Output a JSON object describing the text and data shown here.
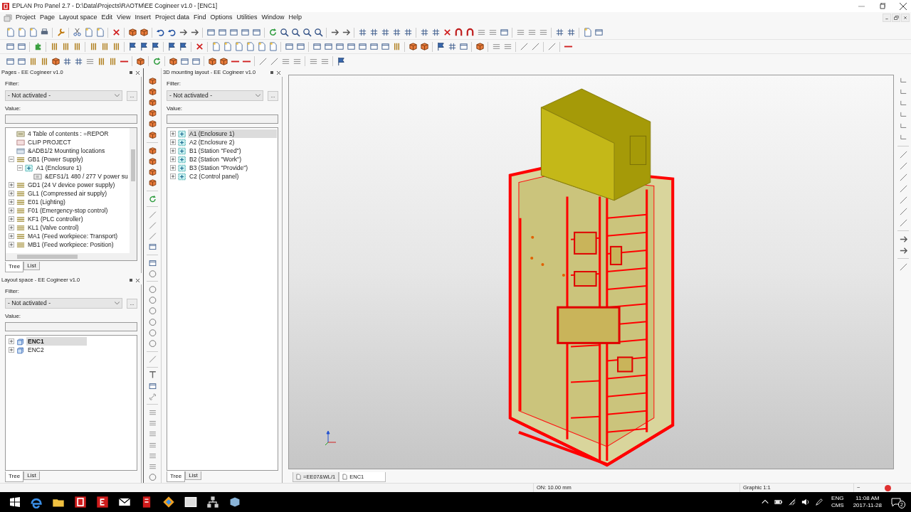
{
  "window": {
    "title": "EPLAN Pro Panel 2.7 - D:\\Data\\Projects\\RAOTM\\EE Cogineer v1.0 - [ENC1]"
  },
  "menu": [
    "Project",
    "Page",
    "Layout space",
    "Edit",
    "View",
    "Insert",
    "Project data",
    "Find",
    "Options",
    "Utilities",
    "Window",
    "Help"
  ],
  "pages_panel": {
    "title": "Pages - EE Cogineer v1.0",
    "filter_label": "Filter:",
    "filter_value": "- Not activated -",
    "more_button": "...",
    "value_label": "Value:",
    "tree": [
      {
        "label": "4 Table of contents : =REPOR",
        "kind": "report"
      },
      {
        "label": "CLIP PROJECT",
        "kind": "page"
      },
      {
        "label": "&ADB1/2 Mounting locations",
        "kind": "layout"
      },
      {
        "label": "GB1 (Power Supply)",
        "kind": "function",
        "expanded": true,
        "children": [
          {
            "label": "A1 (Enclosure 1)",
            "kind": "location",
            "expanded": true,
            "children": [
              {
                "label": "&EFS1/1 480 / 277 V power su",
                "kind": "device"
              }
            ]
          }
        ]
      },
      {
        "label": "GD1 (24 V device power supply)",
        "kind": "function",
        "expanded": false
      },
      {
        "label": "GL1 (Compressed air supply)",
        "kind": "function",
        "expanded": false
      },
      {
        "label": "E01 (Lighting)",
        "kind": "function",
        "expanded": false
      },
      {
        "label": "F01 (Emergency-stop control)",
        "kind": "function",
        "expanded": false
      },
      {
        "label": "KF1 (PLC controller)",
        "kind": "function",
        "expanded": false
      },
      {
        "label": "KL1 (Valve control)",
        "kind": "function",
        "expanded": false
      },
      {
        "label": "MA1 (Feed workpiece: Transport)",
        "kind": "function",
        "expanded": false
      },
      {
        "label": "MB1 (Feed workpiece: Position)",
        "kind": "function",
        "expanded": false
      }
    ],
    "tabs": [
      {
        "label": "Tree",
        "selected": true
      },
      {
        "label": "List",
        "selected": false
      }
    ]
  },
  "layout_panel": {
    "title": "Layout space - EE Cogineer v1.0",
    "filter_label": "Filter:",
    "filter_value": "- Not activated -",
    "more_button": "...",
    "value_label": "Value:",
    "tree": [
      {
        "label": "ENC1",
        "kind": "enclosure",
        "expanded": false,
        "selected": true
      },
      {
        "label": "ENC2",
        "kind": "enclosure",
        "expanded": false,
        "selected": false
      }
    ],
    "tabs": [
      {
        "label": "Tree",
        "selected": true
      },
      {
        "label": "List",
        "selected": false
      }
    ]
  },
  "mounting_panel": {
    "title": "3D mounting layout - EE Cogineer v1.0",
    "filter_label": "Filter:",
    "filter_value": "- Not activated -",
    "more_button": "...",
    "value_label": "Value:",
    "tree": [
      {
        "label": "A1 (Enclosure 1)",
        "kind": "location",
        "expanded": false,
        "selected": true
      },
      {
        "label": "A2 (Enclosure 2)",
        "kind": "location",
        "expanded": false,
        "selected": false
      },
      {
        "label": "B1 (Station \"Feed\")",
        "kind": "location",
        "expanded": false,
        "selected": false
      },
      {
        "label": "B2 (Station \"Work\")",
        "kind": "location",
        "expanded": false,
        "selected": false
      },
      {
        "label": "B3 (Station \"Provide\")",
        "kind": "location",
        "expanded": false,
        "selected": false
      },
      {
        "label": "C2 (Control panel)",
        "kind": "location",
        "expanded": false,
        "selected": false
      }
    ],
    "tabs": [
      {
        "label": "Tree",
        "selected": true
      },
      {
        "label": "List",
        "selected": false
      }
    ]
  },
  "document_tabs": [
    {
      "label": "=EE07&WL/1",
      "selected": false
    },
    {
      "label": "ENC1",
      "selected": true
    }
  ],
  "status_bar": [
    "ON: 10.00 mm",
    "Graphic 1:1",
    "~"
  ],
  "tray": {
    "language": "ENG",
    "layout": "CMS",
    "time": "11:08 AM",
    "date": "2017-11-28",
    "notifications": "2"
  }
}
